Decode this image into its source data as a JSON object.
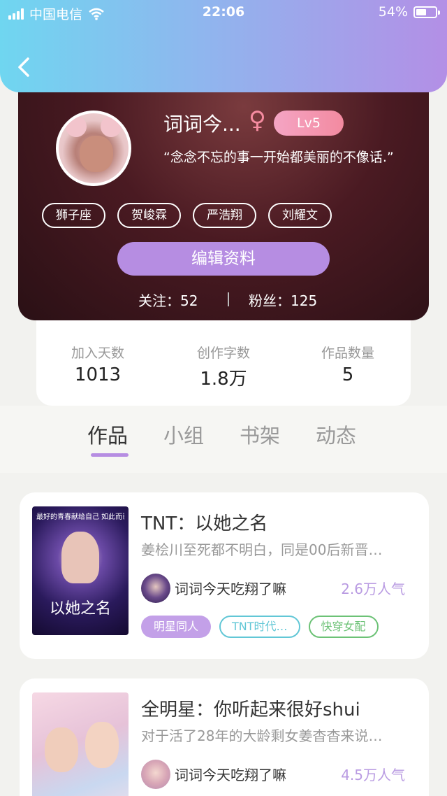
{
  "status_bar": {
    "carrier": "中国电信",
    "time": "22:06",
    "battery": "54%"
  },
  "profile": {
    "username": "词词今...",
    "gender_symbol": "♀",
    "level": "Lv5",
    "motto": "“念念不忘的事一开始都美丽的不像话.”",
    "tags": [
      "狮子座",
      "贺峻霖",
      "严浩翔",
      "刘耀文"
    ],
    "edit_label": "编辑资料",
    "following": "关注：52",
    "followers": "粉丝：125"
  },
  "stats": [
    {
      "label": "加入天数",
      "value": "1013"
    },
    {
      "label": "创作字数",
      "value": "1.8万"
    },
    {
      "label": "作品数量",
      "value": "5"
    }
  ],
  "tabs": [
    "作品",
    "小组",
    "书架",
    "动态"
  ],
  "active_tab": "作品",
  "works": [
    {
      "cover_text": "以她之名",
      "cover_header": "最好的青春献给自己 如此而已",
      "title": "TNT：以她之名",
      "desc": "姜桧川至死都不明白，同是00后新晋…",
      "author": "词词今天吃翔了嘛",
      "popularity": "2.6万人气",
      "tags": [
        "明星同人",
        "TNT时代…",
        "快穿女配"
      ]
    },
    {
      "title": "全明星：你听起来很好shui",
      "desc": "对于活了28年的大龄剩女姜杳杳来说…",
      "author": "词词今天吃翔了嘛",
      "popularity": "4.5万人气"
    }
  ],
  "colors": {
    "accent": "#b68de2",
    "header_start": "#6fd6f0",
    "header_end": "#b38fe6"
  }
}
